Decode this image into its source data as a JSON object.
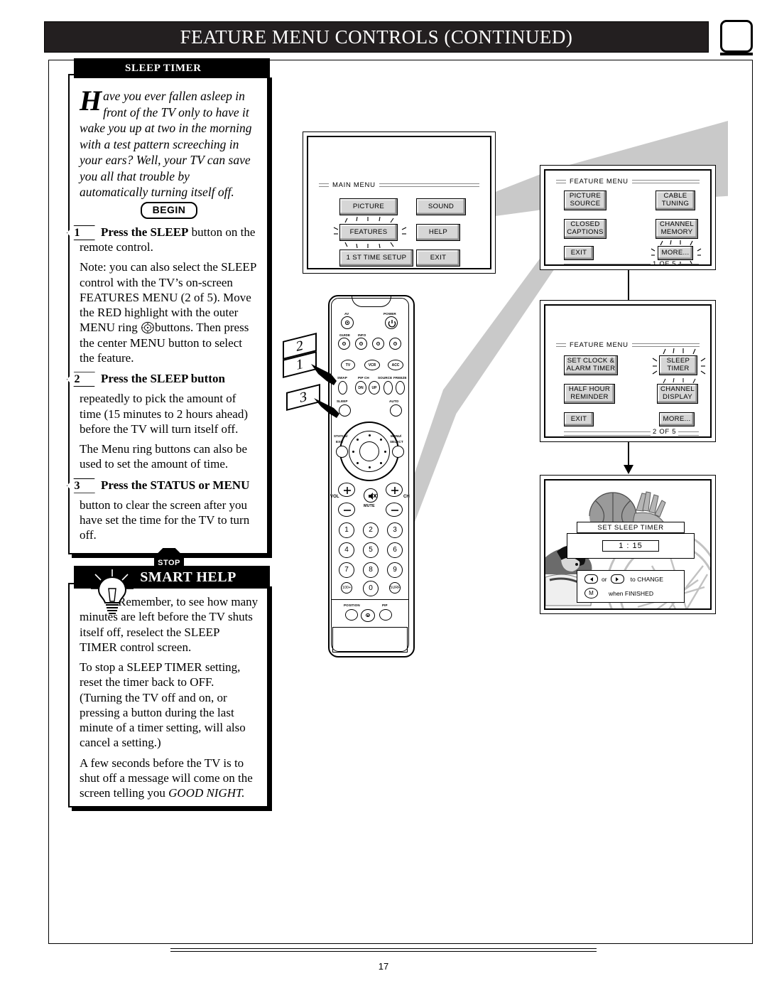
{
  "header": {
    "title_parts": [
      "F",
      "EATURE ",
      "M",
      "ENU ",
      "C",
      "ONTROLS (",
      "CONTINUED",
      ")"
    ],
    "title_plain": "FEATURE MENU CONTROLS (CONTINUED)",
    "corner_icon": "tv-screen-icon"
  },
  "page": {
    "number": "17"
  },
  "sleep_timer_panel": {
    "tab_label": "SLEEP TIMER",
    "intro_dropcap": "H",
    "intro_text": "ave you ever fallen asleep in front of the TV only to have it wake you up at two in the morning with a test pattern screeching in your ears?  Well, your TV can save you all that trouble by automatically turning itself off.",
    "begin_label": "BEGIN",
    "stop_label": "STOP",
    "steps": [
      {
        "number": "1",
        "bold_lead": "Press the SLEEP",
        "rest": " button on the remote control.",
        "extra": "Note: you can also select the SLEEP control with the TV’s on-screen FEATURES MENU (2 of 5). Move the RED highlight with the outer MENU ring",
        "extra2": "buttons. Then press the center MENU button to select the feature."
      },
      {
        "number": "2",
        "bold_lead": "Press the SLEEP button",
        "rest": "",
        "extra": "repeatedly to pick the amount of time (15 minutes to 2 hours ahead) before the TV will turn itself off.",
        "extra2": "The Menu ring buttons can also be used to set the amount of time."
      },
      {
        "number": "3",
        "bold_lead": "Press the STATUS or MENU",
        "rest": "",
        "extra": "button to clear the screen after you have set the time for the TV to turn off.",
        "extra2": ""
      }
    ]
  },
  "smart_help": {
    "title_parts": [
      "S",
      "MART ",
      "H",
      "ELP"
    ],
    "title_plain": "SMART HELP",
    "icon": "lightbulb-icon",
    "paragraphs": [
      "Remember,  to see how many minutes are left before the TV shuts itself off, reselect the SLEEP TIMER control screen.",
      "To stop a SLEEP TIMER setting, reset the timer back to OFF. (Turning the TV off and on, or pressing a button during the last minute of a timer setting, will also cancel a setting.)",
      "A few seconds before the TV is to shut off a message will come on the screen telling you GOOD NIGHT."
    ],
    "paragraph3_italic_tail": "GOOD NIGHT."
  },
  "remote": {
    "labels": {
      "av": "AV",
      "power": "POWER",
      "guide": "GUIDE",
      "info": "INFO",
      "tv": "TV",
      "vcr": "VCR",
      "acc": "ACC",
      "swap": "SWAP",
      "pip_ch": "PIP CH",
      "pip_dn": "DN",
      "pip_up": "UP",
      "source": "SOURCE",
      "freeze": "FREEZE",
      "sleep": "SLEEP",
      "auto": "AUTO",
      "status_exit_1": "STATUS/",
      "status_exit_2": "EXIT",
      "menu_select_1": "MENU/",
      "menu_select_2": "SELECT",
      "vol": "VOL",
      "ch": "CH",
      "mute": "MUTE",
      "position": "POSITION",
      "pip": "PIP"
    },
    "keypad": [
      "1",
      "2",
      "3",
      "4",
      "5",
      "6",
      "7",
      "8",
      "9",
      "100+",
      "0",
      "SURF"
    ],
    "callouts": [
      "2",
      "1",
      "3"
    ]
  },
  "screens": {
    "main_menu": {
      "title": "MAIN MENU",
      "buttons": [
        {
          "label": "PICTURE",
          "highlighted": false
        },
        {
          "label": "SOUND",
          "highlighted": false
        },
        {
          "label": "FEATURES",
          "highlighted": true
        },
        {
          "label": "HELP",
          "highlighted": false
        },
        {
          "label": "1 ST TIME SETUP",
          "highlighted": false
        },
        {
          "label": "EXIT",
          "highlighted": false
        }
      ]
    },
    "feature_menu_1": {
      "title": "FEATURE MENU",
      "page_indicator": "1 OF 5",
      "buttons": [
        {
          "line1": "PICTURE",
          "line2": "SOURCE",
          "highlighted": false
        },
        {
          "line1": "CABLE",
          "line2": "TUNING",
          "highlighted": false
        },
        {
          "line1": "CLOSED",
          "line2": "CAPTIONS",
          "highlighted": false
        },
        {
          "line1": "CHANNEL",
          "line2": "MEMORY",
          "highlighted": false
        },
        {
          "line1": "EXIT",
          "line2": "",
          "highlighted": false
        },
        {
          "line1": "MORE...",
          "line2": "",
          "highlighted": true
        }
      ]
    },
    "feature_menu_2": {
      "title": "FEATURE MENU",
      "page_indicator": "2 OF 5",
      "buttons": [
        {
          "line1": "SET CLOCK &",
          "line2": "ALARM TIMER",
          "highlighted": false
        },
        {
          "line1": "SLEEP",
          "line2": "TIMER",
          "highlighted": true
        },
        {
          "line1": "HALF HOUR",
          "line2": "REMINDER",
          "highlighted": false
        },
        {
          "line1": "CHANNEL",
          "line2": "DISPLAY",
          "highlighted": false
        },
        {
          "line1": "EXIT",
          "line2": "",
          "highlighted": false
        },
        {
          "line1": "MORE...",
          "line2": "",
          "highlighted": false
        }
      ]
    },
    "set_sleep_timer": {
      "title": "SET SLEEP TIMER",
      "value": "1 : 15",
      "hint_change": "to CHANGE",
      "hint_change_or": "or",
      "hint_finished": "when FINISHED",
      "hint_finished_key": "M",
      "background": "basketball-player-photo"
    }
  },
  "colors": {
    "header_bar": "#231f20",
    "osd_button_face": "#d6d6d6",
    "swoosh_gray": "#c9c9c9"
  }
}
